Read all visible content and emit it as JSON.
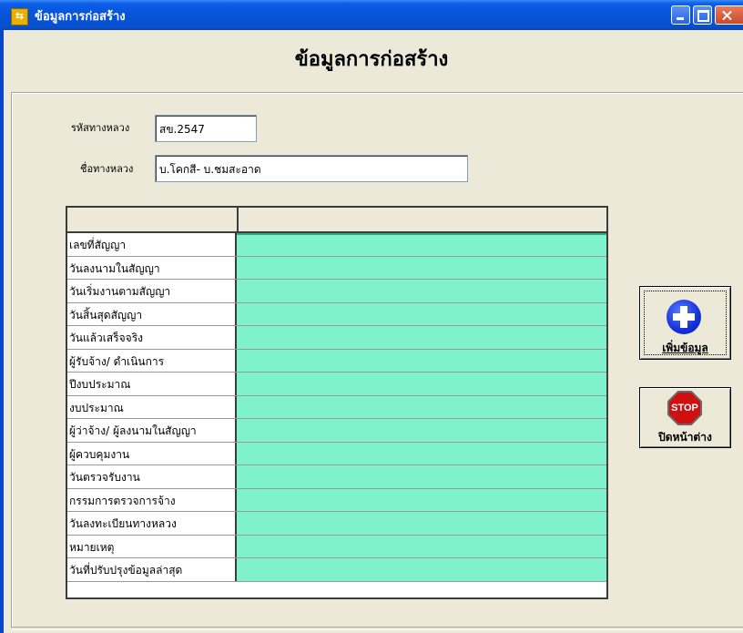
{
  "window": {
    "title": "ข้อมูลการก่อสร้าง"
  },
  "form": {
    "heading": "ข้อมูลการก่อสร้าง",
    "road_code_label": "รหัสทางหลวง",
    "road_code_value": "สข.2547",
    "road_name_label": "ชื่อทางหลวง",
    "road_name_value": "บ.โคกสี- บ.ชมสะอาด"
  },
  "grid": {
    "header": [
      "",
      ""
    ],
    "rows": [
      "เลขที่สัญญา",
      "วันลงนามในสัญญา",
      "วันเริ่มงานตามสัญญา",
      "วันสิ้นสุดสัญญา",
      "วันแล้วเสร็จจริง",
      "ผู้รับจ้าง/ ดำเนินการ",
      "ปีงบประมาณ",
      "งบประมาณ",
      "ผู้ว่าจ้าง/ ผู้ลงนามในสัญญา",
      "ผู้ควบคุมงาน",
      "วันตรวจรับงาน",
      "กรรมการตรวจการจ้าง",
      "วันลงทะเบียนทางหลวง",
      "หมายเหตุ",
      "วันที่ปรับปรุงข้อมูลล่าสุด"
    ],
    "value_cell_color": "#7ff2cc"
  },
  "buttons": {
    "add_label": "เพิ่มข้อมูล",
    "add_icon": "plus-circle-icon",
    "close_label": "ปิดหน้าต่าง",
    "close_icon": "stop-sign-icon",
    "stop_sign_text": "STOP"
  },
  "colors": {
    "titlebar": "#0754d6",
    "window_bg": "#ece9d8"
  }
}
